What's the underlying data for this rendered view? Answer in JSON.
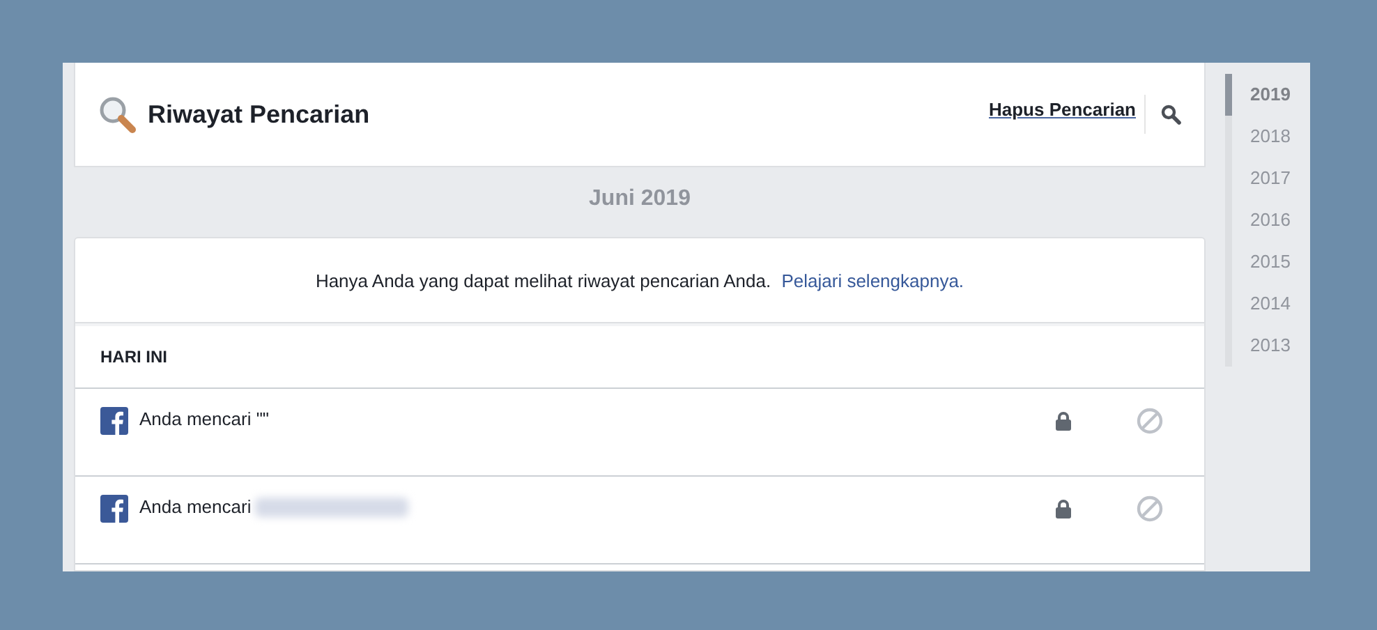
{
  "header": {
    "title": "Riwayat Pencarian",
    "clear_link": "Hapus Pencarian"
  },
  "month": "Juni 2019",
  "notice": {
    "text": "Hanya Anda yang dapat melihat riwayat pencarian Anda.",
    "link": "Pelajari selengkapnya."
  },
  "section": "HARI INI",
  "entries": [
    {
      "text": "Anda mencari \"\"",
      "redacted": false
    },
    {
      "text": "Anda mencari",
      "redacted": true
    }
  ],
  "years": [
    {
      "label": "2019",
      "selected": true
    },
    {
      "label": "2018",
      "selected": false
    },
    {
      "label": "2017",
      "selected": false
    },
    {
      "label": "2016",
      "selected": false
    },
    {
      "label": "2015",
      "selected": false
    },
    {
      "label": "2014",
      "selected": false
    },
    {
      "label": "2013",
      "selected": false
    }
  ]
}
